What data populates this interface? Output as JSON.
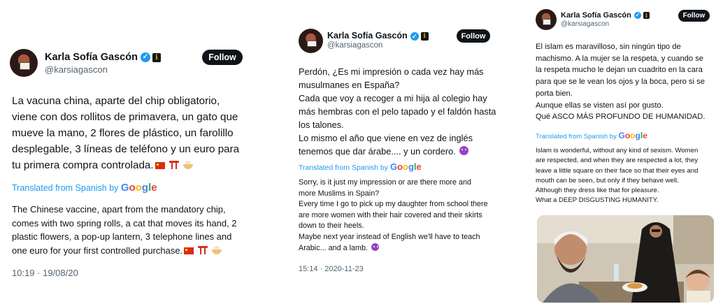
{
  "tweet1": {
    "name": "Karla Sofía Gascón",
    "handle": "@karsiagascon",
    "follow": "Follow",
    "body": "La vacuna china, aparte del chip obligatorio,\nviene con dos rollitos de primavera, un gato que\nmueve la mano, 2 flores de plástico, un farolillo\ndesplegable, 3 líneas de teléfono y un euro para\ntu primera compra controlada.",
    "translated_label": "Translated from Spanish by",
    "translation": "The Chinese vaccine, apart from the mandatory chip,\ncomes with two spring rolls, a cat that moves its hand, 2\nplastic flowers, a pop-up lantern, 3 telephone lines and\none euro for your first controlled purchase.",
    "timestamp": "10:19 · 19/08/20"
  },
  "tweet2": {
    "name": "Karla Sofía Gascón",
    "handle": "@karsiagascon",
    "follow": "Follow",
    "body": "Perdón, ¿Es mi impresión o cada vez hay más\nmusulmanes en España?\nCada que voy a recoger a mi hija al colegio hay\nmás hembras con el pelo tapado y el faldón hasta\nlos talones.\nLo mismo el año que viene en vez de inglés\ntenemos que dar árabe.... y un cordero.",
    "translated_label": "Translated from Spanish by",
    "translation": "Sorry, is it just my impression or are there more and\nmore Muslims in Spain?\nEvery time I go to pick up my daughter from school there\nare more women with their hair covered and their skirts\ndown to their heels.\nMaybe next year instead of English we'll have to teach\nArabic... and a lamb.",
    "timestamp": "15:14 · 2020-11-23"
  },
  "tweet3": {
    "name": "Karla Sofía Gascón",
    "handle": "@karsiagascon",
    "follow": "Follow",
    "body": "El islam es maravilloso, sin ningún tipo de\nmachismo. A la mujer se la respeta, y cuando se\nla respeta mucho le dejan un cuadrito en la cara\npara que se le vean los ojos y la boca, pero si se\nporta bien.\nAunque ellas se visten así por gusto.\nQué ASCO MÁS PROFUNDO DE HUMANIDAD.",
    "translated_label": "Translated from Spanish by",
    "translation": "Islam is wonderful, without any kind of sexism. Women\nare respected, and when they are respected a lot, they\nleave a little square on their face so that their eyes and\nmouth can be seen, but only if they behave well.\nAlthough they dress like that for pleasure.\nWhat a DEEP DISGUSTING HUMANITY."
  },
  "google_logo": "Google",
  "badges": {
    "verified": "✓",
    "org": "i"
  },
  "colors": {
    "accent": "#1d9bf0",
    "follow_bg": "#0f1419",
    "muted": "#536471"
  },
  "icons": [
    "chinese-flag-icon",
    "torii-gate-icon",
    "ramen-bowl-icon",
    "crying-face-icon",
    "verified-badge-icon"
  ]
}
